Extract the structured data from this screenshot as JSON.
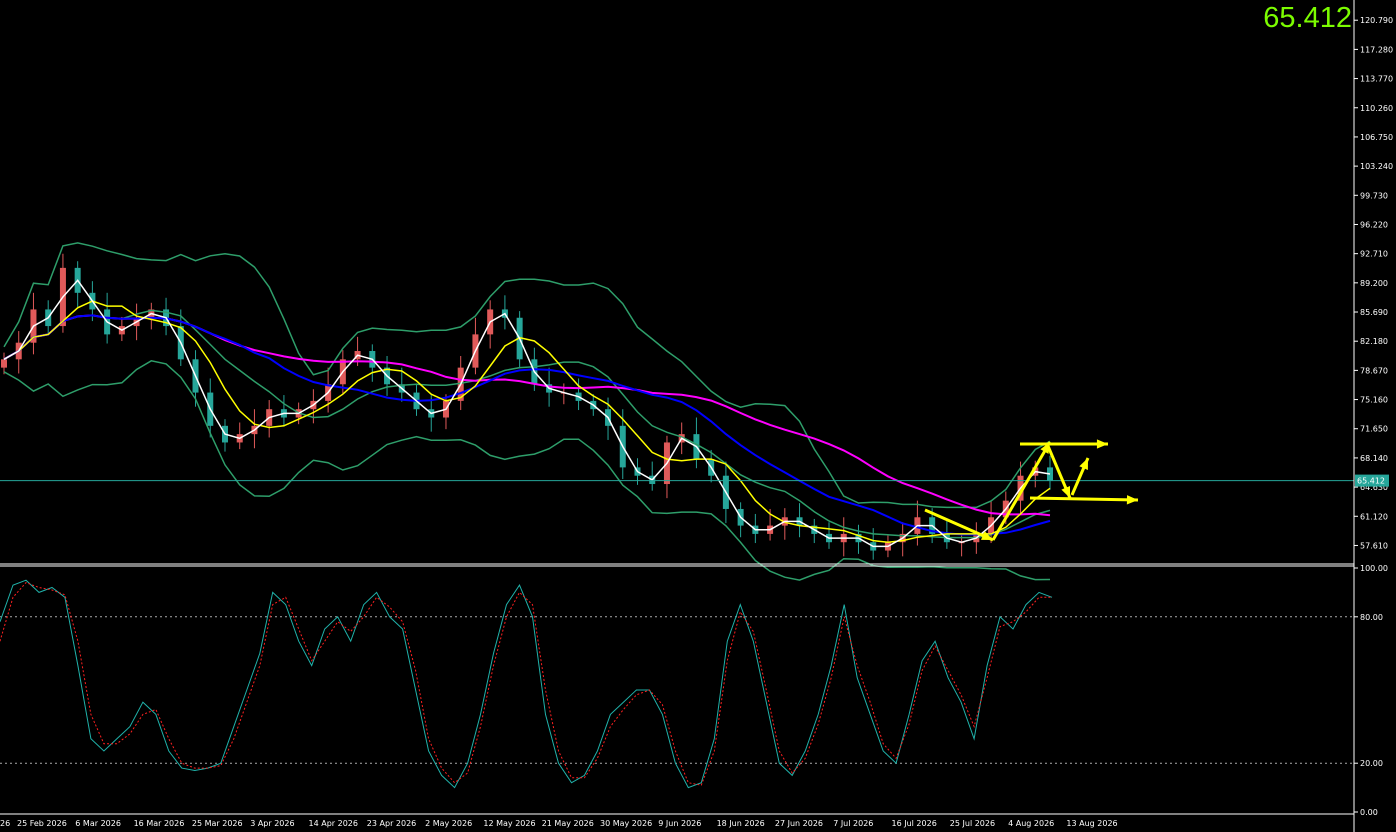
{
  "current_price": "65.412",
  "price_tag": "65.412",
  "colors": {
    "background": "#000000",
    "bull_candle": "#e05a5a",
    "bear_candle": "#26a69a",
    "bollinger": "#2e9e6a",
    "ma_white": "#ffffff",
    "ma_yellow": "#ffff00",
    "ma_blue": "#0000ff",
    "ma_magenta": "#ff00ff",
    "stoch_main": "#20b2aa",
    "stoch_signal": "#ff2020",
    "annotation": "#ffff00",
    "price_text": "#7cfc00"
  },
  "price_axis_labels": [
    "120.790",
    "117.280",
    "113.770",
    "110.260",
    "106.750",
    "103.240",
    "99.730",
    "96.220",
    "92.710",
    "89.200",
    "85.690",
    "82.180",
    "78.670",
    "75.160",
    "71.650",
    "68.140",
    "64.630",
    "61.120",
    "57.610"
  ],
  "osc_axis_labels": [
    "100.00",
    "80.00",
    "20.00",
    "0.00"
  ],
  "date_labels": [
    "26",
    "25 Feb 2026",
    "6 Mar 2026",
    "16 Mar 2026",
    "25 Mar 2026",
    "3 Apr 2026",
    "14 Apr 2026",
    "23 Apr 2026",
    "2 May 2026",
    "12 May 2026",
    "21 May 2026",
    "30 May 2026",
    "9 Jun 2026",
    "18 Jun 2026",
    "27 Jun 2026",
    "7 Jul 2026",
    "16 Jul 2026",
    "25 Jul 2026",
    "4 Aug 2026",
    "13 Aug 2026"
  ],
  "chart_data": [
    {
      "type": "candlestick",
      "title": "",
      "ylim": [
        55.5,
        122.5
      ],
      "y_ticks": [
        120.79,
        117.28,
        113.77,
        110.26,
        106.75,
        103.24,
        99.73,
        96.22,
        92.71,
        89.2,
        85.69,
        82.18,
        78.67,
        75.16,
        71.65,
        68.14,
        64.63,
        61.12,
        57.61
      ],
      "x_labels": [
        "26",
        "25 Feb 2026",
        "6 Mar 2026",
        "16 Mar 2026",
        "25 Mar 2026",
        "3 Apr 2026",
        "14 Apr 2026",
        "23 Apr 2026",
        "2 May 2026",
        "12 May 2026",
        "21 May 2026",
        "30 May 2026",
        "9 Jun 2026",
        "18 Jun 2026",
        "27 Jun 2026",
        "7 Jul 2026",
        "16 Jul 2026",
        "25 Jul 2026",
        "4 Aug 2026",
        "13 Aug 2026"
      ],
      "close_path": [
        80,
        82,
        86,
        84,
        91,
        88,
        86,
        83,
        84,
        85,
        86,
        84,
        80,
        76,
        72,
        70,
        71,
        72,
        74,
        73,
        74,
        75,
        77,
        80,
        81,
        79,
        77,
        76,
        74,
        73,
        75,
        79,
        83,
        86,
        85,
        80,
        77,
        76,
        76,
        75,
        74,
        72,
        67,
        66,
        65,
        70,
        71,
        68,
        66,
        62,
        60,
        59,
        60,
        61,
        60,
        59,
        58,
        59,
        58,
        57,
        58,
        59,
        61,
        59,
        58,
        58,
        59,
        61,
        63,
        66,
        67,
        65.412
      ],
      "current_price": 65.412
    },
    {
      "type": "line",
      "title": "",
      "ylim": [
        0,
        100
      ],
      "y_ticks": [
        100,
        80,
        20,
        0
      ],
      "levels": [
        80,
        20
      ],
      "series": [
        {
          "values": [
            78,
            93,
            95,
            90,
            92,
            88,
            60,
            30,
            25,
            30,
            35,
            45,
            40,
            25,
            18,
            17,
            18,
            20,
            35,
            50,
            65,
            90,
            85,
            70,
            60,
            75,
            80,
            70,
            85,
            90,
            80,
            75,
            50,
            25,
            15,
            10,
            20,
            40,
            65,
            85,
            93,
            80,
            40,
            20,
            12,
            15,
            25,
            40,
            45,
            50,
            50,
            40,
            20,
            10,
            12,
            30,
            70,
            85,
            70,
            45,
            20,
            15,
            25,
            40,
            60,
            85,
            55,
            40,
            25,
            20,
            40,
            62,
            70,
            55,
            45,
            30,
            60,
            80,
            75,
            85,
            90,
            88
          ]
        },
        {
          "values": [
            70,
            88,
            94,
            92,
            91,
            89,
            70,
            40,
            28,
            28,
            32,
            40,
            42,
            30,
            20,
            18,
            18,
            19,
            30,
            45,
            60,
            85,
            88,
            75,
            62,
            70,
            78,
            74,
            80,
            88,
            84,
            78,
            58,
            30,
            18,
            12,
            16,
            35,
            60,
            80,
            90,
            85,
            50,
            25,
            14,
            14,
            22,
            35,
            42,
            48,
            50,
            44,
            25,
            12,
            11,
            25,
            62,
            82,
            74,
            50,
            25,
            16,
            22,
            36,
            55,
            80,
            60,
            45,
            28,
            22,
            36,
            58,
            68,
            58,
            48,
            35,
            55,
            76,
            78,
            82,
            88,
            88
          ]
        }
      ]
    }
  ]
}
